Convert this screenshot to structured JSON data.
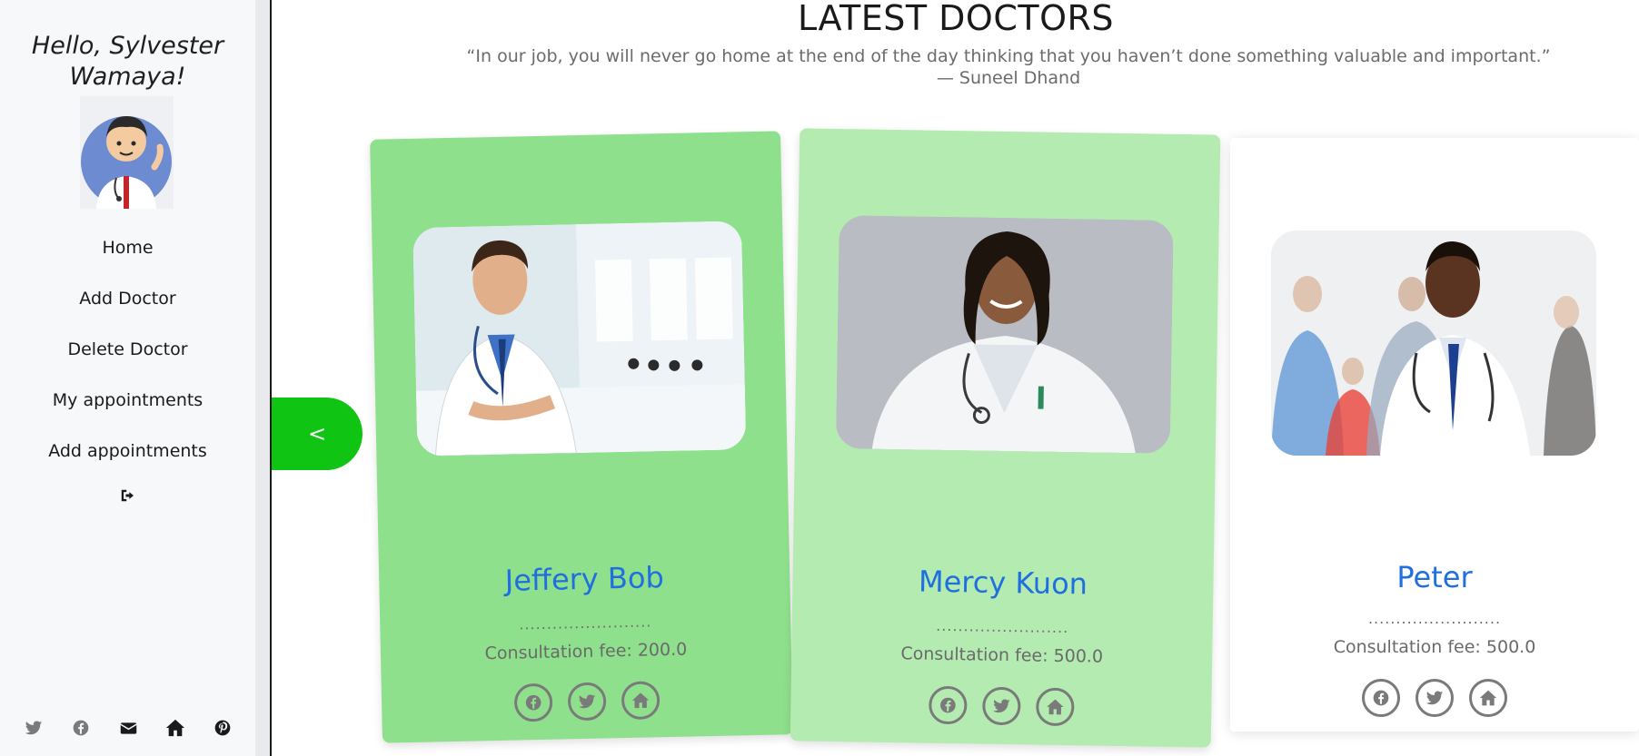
{
  "sidebar": {
    "greeting": "Hello, Sylvester Wamaya!",
    "nav": [
      {
        "label": "Home"
      },
      {
        "label": "Add Doctor"
      },
      {
        "label": "Delete Doctor"
      },
      {
        "label": "My appointments"
      },
      {
        "label": "Add appointments"
      }
    ],
    "logout_icon": "logout-icon",
    "social_icons": [
      "twitter-icon",
      "facebook-icon",
      "envelope-icon",
      "home-icon",
      "pinterest-icon"
    ]
  },
  "main": {
    "title": "LATEST DOCTORS",
    "quote": "“In our job, you will never go home at the end of the day thinking that you haven’t done something valuable and important.” — Suneel Dhand",
    "prev_label": "<"
  },
  "doctors": [
    {
      "name": "Jeffery Bob",
      "dots": "........................",
      "fee_label": "Consultation fee: ",
      "fee": "200.0"
    },
    {
      "name": "Mercy Kuon",
      "dots": "........................",
      "fee_label": "Consultation fee: ",
      "fee": "500.0"
    },
    {
      "name": "Peter",
      "dots": "........................",
      "fee_label": "Consultation fee: ",
      "fee": "500.0"
    }
  ],
  "colors": {
    "accent_green": "#10c414",
    "card1_bg": "#8fe08c",
    "card2_bg": "#b4ebb1",
    "name_blue": "#1f6fe0"
  }
}
